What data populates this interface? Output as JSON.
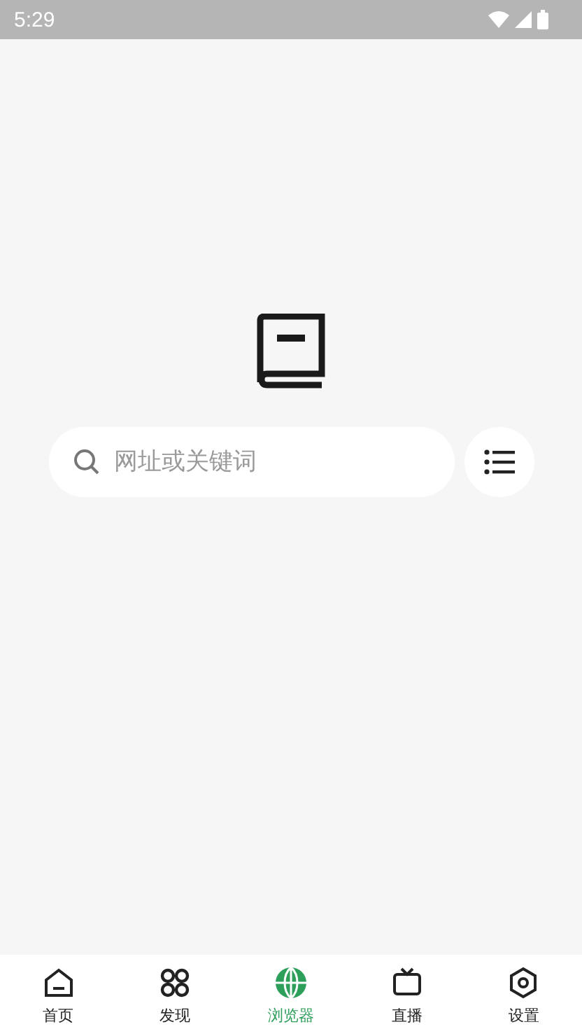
{
  "status_bar": {
    "time": "5:29"
  },
  "search": {
    "placeholder": "网址或关键词"
  },
  "nav": [
    {
      "label": "首页",
      "selected": false
    },
    {
      "label": "发现",
      "selected": false
    },
    {
      "label": "浏览器",
      "selected": true
    },
    {
      "label": "直播",
      "selected": false
    },
    {
      "label": "设置",
      "selected": false
    }
  ]
}
